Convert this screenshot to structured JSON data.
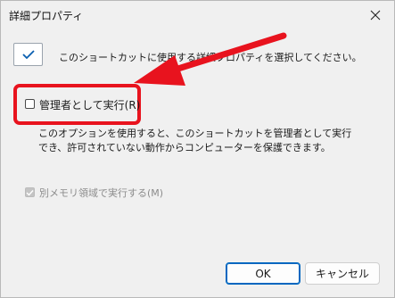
{
  "window": {
    "title": "詳細プロパティ"
  },
  "header": {
    "description": "このショートカットに使用する詳細プロパティを選択してください。"
  },
  "options": {
    "run_as_admin": {
      "label": "管理者として実行(R)",
      "checked": false
    },
    "info_text": "このオプションを使用すると、このショートカットを管理者として実行でき、許可されていない動作からコンピューターを保護できます。",
    "separate_memory": {
      "label": "別メモリ領域で実行する(M)",
      "checked": true,
      "enabled": false
    }
  },
  "buttons": {
    "ok": "OK",
    "cancel": "キャンセル"
  },
  "colors": {
    "highlight": "#e8131e",
    "accent": "#0067c0"
  }
}
